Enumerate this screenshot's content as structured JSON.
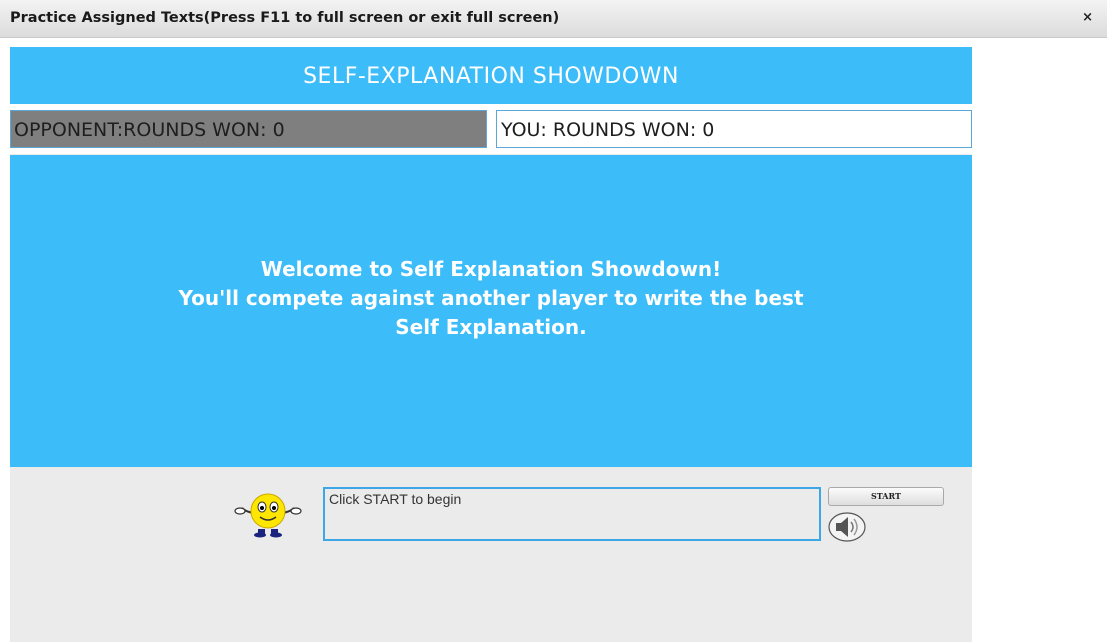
{
  "window": {
    "title": "Practice Assigned Texts(Press F11 to full screen or exit full screen)",
    "close_glyph": "×"
  },
  "game": {
    "header_title": "SELF-EXPLANATION SHOWDOWN",
    "opponent_score": "OPPONENT:ROUNDS WON: 0",
    "you_score": "YOU: ROUNDS WON: 0",
    "welcome_lines": [
      "Welcome to Self Explanation Showdown!",
      "You'll compete against another player to write the best",
      "Self Explanation."
    ],
    "message_text": "Click START to begin",
    "start_label": "START",
    "icons": {
      "agent": "smiley-agent-icon",
      "speaker": "speaker-icon"
    },
    "colors": {
      "primary_blue": "#3cbcf8",
      "panel_gray": "#ebebeb",
      "opponent_gray": "#7f7f7f",
      "border_blue": "#3ca6e6"
    }
  }
}
